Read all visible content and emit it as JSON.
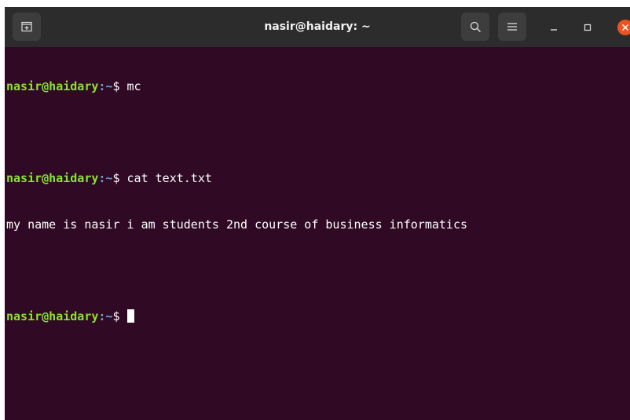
{
  "window": {
    "title": "nasir@haidary: ~"
  },
  "colors": {
    "terminal_bg": "#300a24",
    "titlebar_bg": "#2c2c2c",
    "prompt_user": "#8ae234",
    "prompt_path": "#729fcf",
    "close_button": "#e95420"
  },
  "icons": {
    "new_tab": "new-tab-icon",
    "search": "search-icon",
    "menu": "hamburger-menu-icon",
    "minimize": "minimize-icon",
    "maximize": "maximize-icon",
    "close": "close-icon"
  },
  "terminal": {
    "prompt_user_host": "nasir@haidary",
    "prompt_path": ":~",
    "prompt_symbol": "$ ",
    "command_1": "mc",
    "command_2": "cat text.txt",
    "output_1": "my name is nasir i am students 2nd course of business informatics"
  }
}
